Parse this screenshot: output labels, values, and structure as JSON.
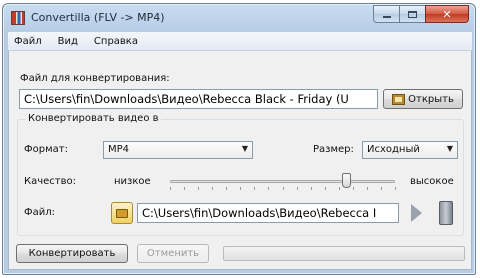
{
  "window": {
    "title": "Convertilla  (FLV -> MP4)",
    "min_icon": "minimize-icon",
    "max_icon": "maximize-icon",
    "close_icon": "close-icon"
  },
  "menu": [
    "Файл",
    "Вид",
    "Справка"
  ],
  "source": {
    "label": "Файл для конвертирования:",
    "value": "C:\\Users\\fin\\Downloads\\Видео\\Rebecca Black - Friday (U",
    "open_label": "Открыть"
  },
  "convert_group": {
    "title": "Конвертировать видео в",
    "format_label": "Формат:",
    "format_value": "MP4",
    "size_label": "Размер:",
    "size_value": "Исходный",
    "quality_label": "Качество:",
    "quality_low": "низкое",
    "quality_high": "высокое",
    "quality_level": 0.78,
    "output_label": "Файл:",
    "output_value": "C:\\Users\\fin\\Downloads\\Видео\\Rebecca I"
  },
  "actions": {
    "convert_label": "Конвертировать",
    "cancel_label": "Отменить",
    "progress": 0
  },
  "colors": {
    "titlebar": "#c9dcf1",
    "close_button": "#c23a22",
    "client_bg": "#f0f0f0"
  }
}
